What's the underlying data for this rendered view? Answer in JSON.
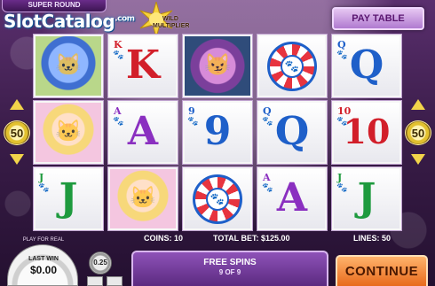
{
  "top": {
    "super_round": "SUPER ROUND",
    "logo_text": "SlotCatalog",
    "logo_suffix": ".com",
    "wild_label": "WILD MULTIPLIER",
    "paytable_label": "PAY TABLE"
  },
  "reels": [
    [
      {
        "type": "character",
        "name": "blue-cat"
      },
      {
        "type": "character",
        "name": "blonde-cat"
      },
      {
        "type": "card",
        "rank": "J"
      }
    ],
    [
      {
        "type": "card",
        "rank": "K"
      },
      {
        "type": "card",
        "rank": "A"
      },
      {
        "type": "character",
        "name": "blonde-cat"
      }
    ],
    [
      {
        "type": "character",
        "name": "purple-cat"
      },
      {
        "type": "card",
        "rank": "9"
      },
      {
        "type": "poker-chip"
      }
    ],
    [
      {
        "type": "poker-chip"
      },
      {
        "type": "card",
        "rank": "Q"
      },
      {
        "type": "card",
        "rank": "A"
      }
    ],
    [
      {
        "type": "card",
        "rank": "Q"
      },
      {
        "type": "card",
        "rank": "10"
      },
      {
        "type": "card",
        "rank": "J"
      }
    ]
  ],
  "side": {
    "left_lines": "50",
    "right_lines": "50"
  },
  "bottom": {
    "coins": "COINS: 10",
    "total_bet": "TOTAL BET: $125.00",
    "lines": "LINES: 50",
    "play_for_real": "PLAY FOR REAL",
    "last_win_label": "LAST WIN",
    "last_win_value": "$0.00",
    "coin_value": "0.25",
    "free_spins_title": "FREE SPINS",
    "free_spins_count": "9 OF 9",
    "continue_label": "CONTINUE"
  },
  "colors": {
    "background": "#3b1d4a",
    "king_red": "#d21f2a",
    "queen_blue": "#1e5fc9",
    "ace_purple": "#8a2fc0",
    "jack_green": "#1e9a3e",
    "continue_orange": "#e86a1c"
  }
}
